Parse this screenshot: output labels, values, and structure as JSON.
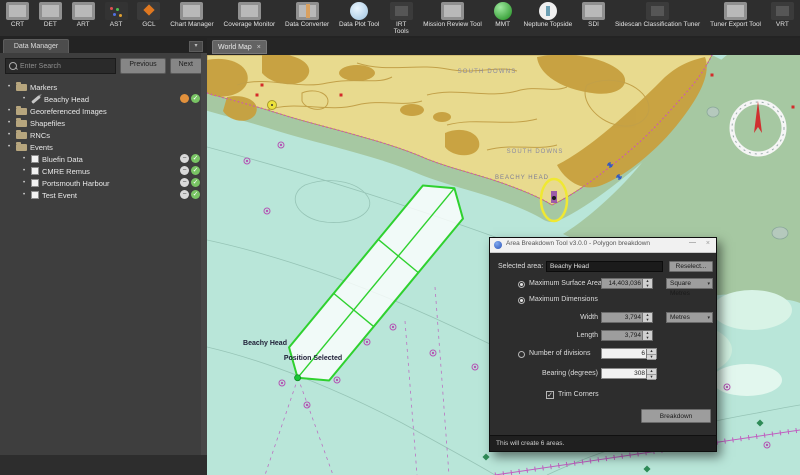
{
  "colors": {
    "accent_green": "#2fd12f",
    "sea": "#b9e6d9",
    "shallow_band": "#a6c8a2",
    "land": "#e8da8e",
    "land_dark": "#c7a03e",
    "magenta": "#c060c0",
    "dialog_bg": "#2d2d2d",
    "panel_bg": "#3e3e3e"
  },
  "icons": {
    "minimize": "—",
    "close": "×",
    "tab_close": "×",
    "dropdown_arrow": "▾",
    "spin_up": "▴",
    "spin_down": "▾",
    "check": "✓",
    "minus": "−",
    "bullet": "•",
    "panel_menu": "▾"
  },
  "toolbar": {
    "items": [
      {
        "label": "CRT",
        "icon": "crt-icon"
      },
      {
        "label": "DET",
        "icon": "det-icon"
      },
      {
        "label": "ART",
        "icon": "art-icon"
      },
      {
        "label": "AST",
        "icon": "ast-icon"
      },
      {
        "label": "GCL",
        "icon": "gcl-icon"
      },
      {
        "label": "Chart Manager",
        "icon": "chart-manager-icon"
      },
      {
        "label": "Coverage Monitor",
        "icon": "coverage-monitor-icon"
      },
      {
        "label": "Data Converter",
        "icon": "data-converter-icon"
      },
      {
        "label": "Data Plot Tool",
        "icon": "data-plot-tool-icon"
      },
      {
        "label": "IRT Tools",
        "icon": "irt-tools-icon"
      },
      {
        "label": "Mission Review Tool",
        "icon": "mission-review-tool-icon"
      },
      {
        "label": "MMT",
        "icon": "mmt-icon"
      },
      {
        "label": "Neptune Topside",
        "icon": "neptune-topside-icon"
      },
      {
        "label": "SDI",
        "icon": "sdi-icon"
      },
      {
        "label": "Sidescan Classification Tuner",
        "icon": "sidescan-classification-tuner-icon"
      },
      {
        "label": "Tuner Export Tool",
        "icon": "tuner-export-tool-icon"
      },
      {
        "label": "VRT",
        "icon": "vrt-icon"
      }
    ]
  },
  "sidebar": {
    "tab_label": "Data Manager",
    "search": {
      "placeholder": "Enter Search",
      "previous_label": "Previous",
      "next_label": "Next"
    },
    "tree": [
      {
        "label": "Markers"
      },
      {
        "label": "Beachy Head"
      },
      {
        "label": "Georeferenced Images"
      },
      {
        "label": "Shapefiles"
      },
      {
        "label": "RNCs"
      },
      {
        "label": "Events"
      },
      {
        "label": "Bluefin Data"
      },
      {
        "label": "CMRE Remus"
      },
      {
        "label": "Portsmouth Harbour"
      },
      {
        "label": "Test Event"
      }
    ]
  },
  "map": {
    "tab_label": "World Map",
    "labels": {
      "south_downs_upper": "SOUTH DOWNS",
      "south_downs_lower": "SOUTH DOWNS",
      "beachy_head_chart": "BEACHY HEAD",
      "selected_marker": "Beachy Head",
      "position_selected": "Position Selected"
    }
  },
  "dialog": {
    "title": "Area Breakdown Tool v3.0.0 - Polygon breakdown",
    "selected_area_label": "Selected area:",
    "selected_area_value": "Beachy Head",
    "reselect_label": "Reselect...",
    "fields": {
      "max_surface_label": "Maximum Surface Area",
      "max_surface_value": "14,403,036",
      "max_surface_unit": "Square Metres",
      "max_dimensions_label": "Maximum Dimensions",
      "width_label": "Width",
      "width_value": "3,794",
      "width_unit": "Metres",
      "length_label": "Length",
      "length_value": "3,794",
      "divisions_label": "Number of divisions",
      "divisions_value": "6",
      "bearing_label": "Bearing (degrees)",
      "bearing_value": "308",
      "trim_corners_label": "Trim Corners"
    },
    "breakdown_label": "Breakdown",
    "status": "This will create 6 areas."
  }
}
